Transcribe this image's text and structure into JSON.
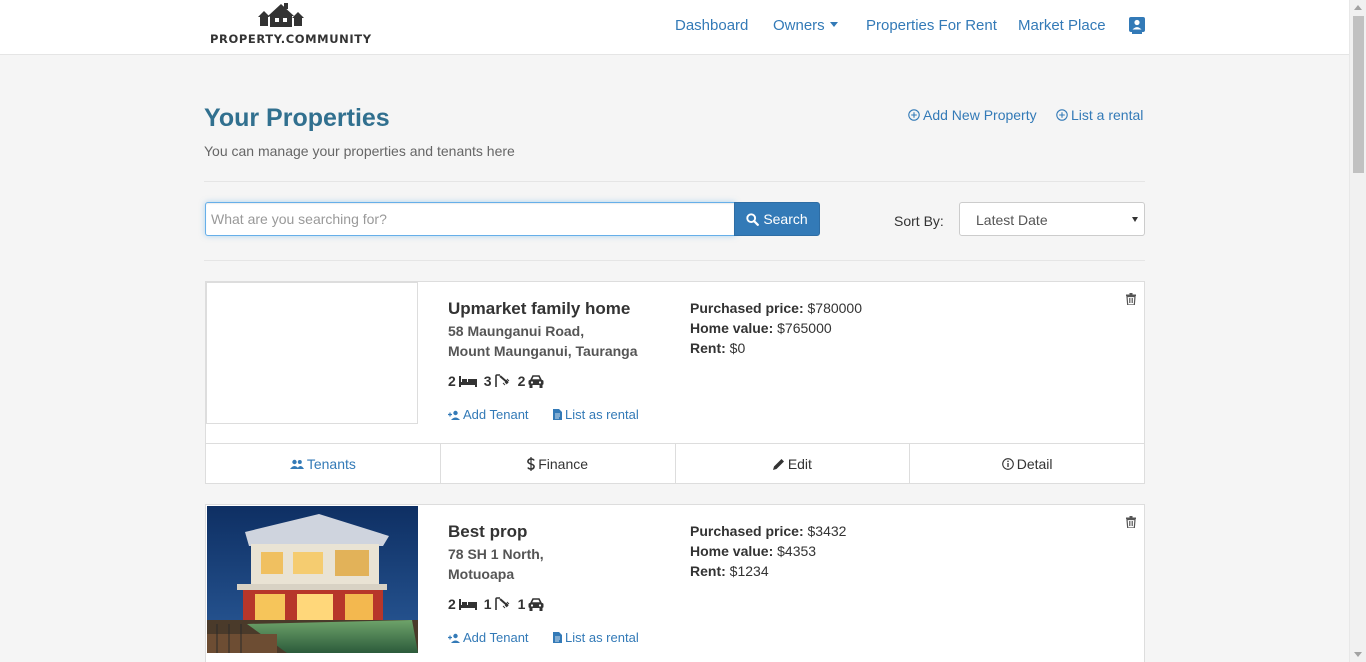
{
  "brand": {
    "logo_text": "PROPERTY.COMMUNITY"
  },
  "nav": {
    "dashboard": "Dashboard",
    "owners": "Owners",
    "properties_for_rent": "Properties For Rent",
    "market_place": "Market Place",
    "profile_icon": "user-card-icon"
  },
  "page": {
    "title": "Your Properties",
    "subtitle": "You can manage your properties and tenants here",
    "add_new_property": "Add New Property",
    "list_a_rental": "List a rental"
  },
  "search": {
    "placeholder": "What are you searching for?",
    "value": "",
    "button": "Search"
  },
  "sort": {
    "label": "Sort By:",
    "selected": "Latest Date"
  },
  "colors": {
    "accent": "#337ab7",
    "heading": "#31708f"
  },
  "properties": [
    {
      "title": "Upmarket family home",
      "address_line1": "58 Maunganui Road,",
      "address_line2": "Mount Maunganui, Tauranga",
      "bedrooms": "2",
      "bathrooms": "3",
      "parking": "2",
      "add_tenant": "Add Tenant",
      "list_as_rental": "List as rental",
      "purchased_label": "Purchased price:",
      "purchased_value": "$780000",
      "home_value_label": "Home value:",
      "home_value_value": "$765000",
      "rent_label": "Rent:",
      "rent_value": "$0",
      "tab_tenants": "Tenants",
      "tab_finance": "Finance",
      "tab_edit": "Edit",
      "tab_detail": "Detail"
    },
    {
      "title": "Best prop",
      "address_line1": "78 SH 1 North,",
      "address_line2": "Motuoapa",
      "bedrooms": "2",
      "bathrooms": "1",
      "parking": "1",
      "add_tenant": "Add Tenant",
      "list_as_rental": "List as rental",
      "purchased_label": "Purchased price:",
      "purchased_value": "$3432",
      "home_value_label": "Home value:",
      "home_value_value": "$4353",
      "rent_label": "Rent:",
      "rent_value": "$1234"
    }
  ]
}
